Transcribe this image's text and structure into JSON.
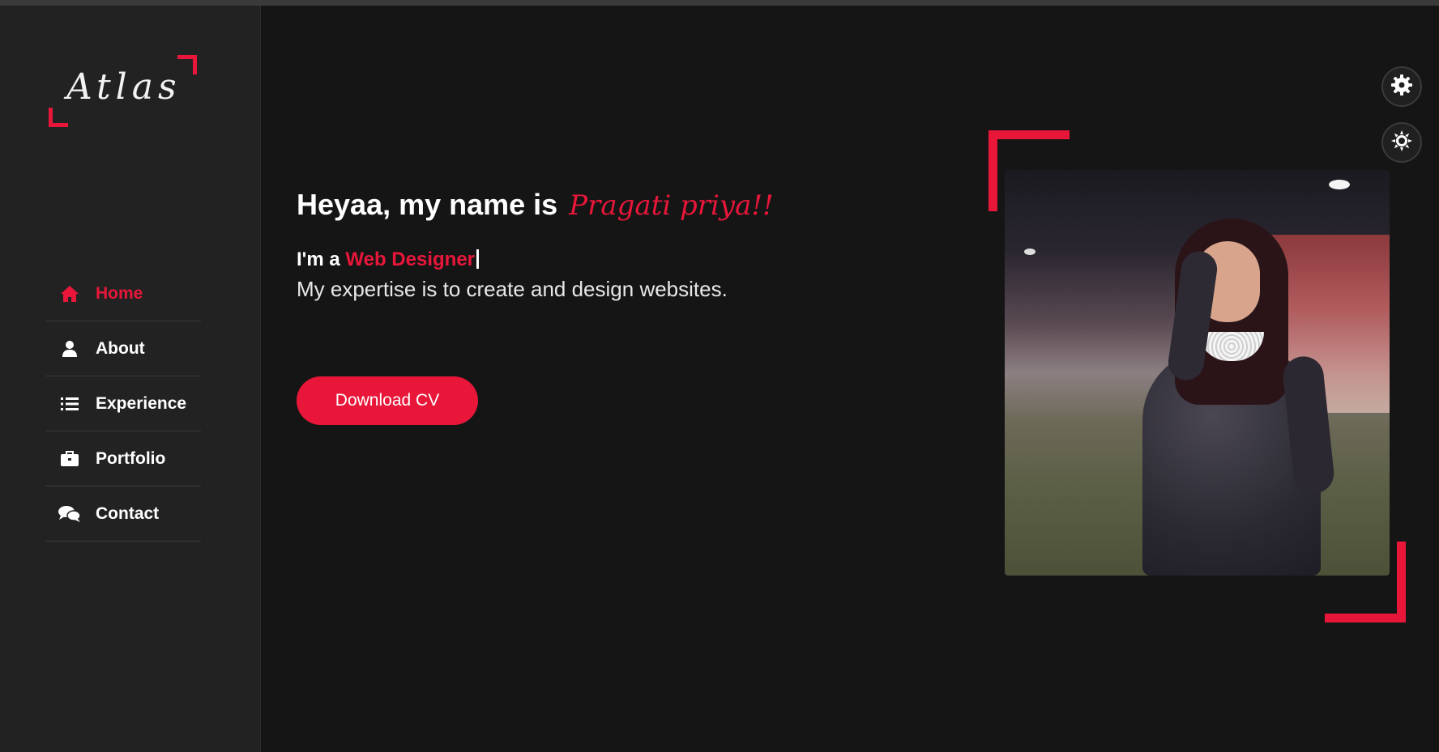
{
  "brand": {
    "logo_text": "Atlas",
    "accent_color": "#e8173a"
  },
  "nav": {
    "items": [
      {
        "label": "Home",
        "icon": "home-icon",
        "active": true
      },
      {
        "label": "About",
        "icon": "user-icon",
        "active": false
      },
      {
        "label": "Experience",
        "icon": "list-icon",
        "active": false
      },
      {
        "label": "Portfolio",
        "icon": "briefcase-icon",
        "active": false
      },
      {
        "label": "Contact",
        "icon": "chat-icon",
        "active": false
      }
    ]
  },
  "hero": {
    "greeting": "Heyaa, my name is",
    "name": "Pragati priya!!",
    "role_prefix": "I'm a",
    "role": "Web Designer",
    "tagline": "My expertise is to create and design websites.",
    "cta_label": "Download CV"
  },
  "widgets": {
    "settings_icon": "gear-icon",
    "theme_icon": "sun-icon"
  }
}
